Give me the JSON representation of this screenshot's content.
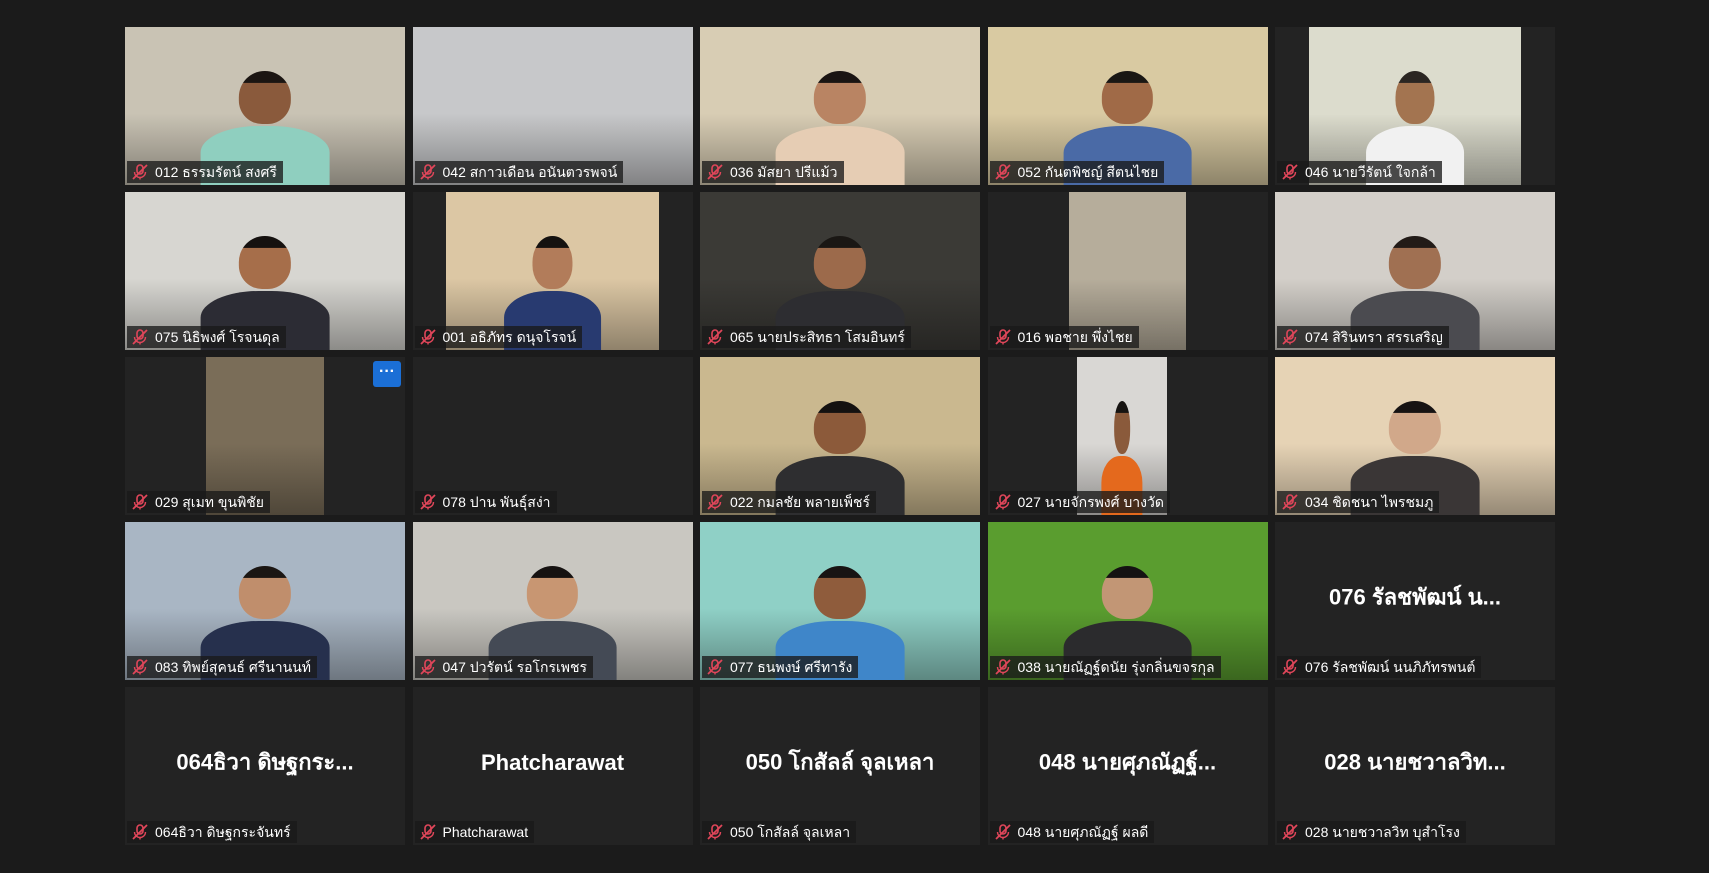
{
  "meeting": {
    "more_options_symbol": "···",
    "participants": [
      {
        "label": "012 ธรรมรัตน์ สงศรี",
        "video": true,
        "bg": "#c9c3b4",
        "skin": "#8a5a3c",
        "hair": "#1b1512",
        "shirt": "#8fcfbf"
      },
      {
        "label": "042 สกาวเดือน อนันตวรพจน์",
        "video": true,
        "bg": "#c7c8ca",
        "skin": null,
        "hair": null,
        "shirt": null
      },
      {
        "label": "036 มัสยา ปรีแม้ว",
        "video": true,
        "bg": "#d8cdb4",
        "skin": "#b98463",
        "hair": "#1a1412",
        "shirt": "#e6cdb4"
      },
      {
        "label": "052 กันตพิชญ์ สีตนไชย",
        "video": true,
        "bg": "#d9caa2",
        "skin": "#a06a47",
        "hair": "#1a1714",
        "shirt": "#4a6aa6"
      },
      {
        "label": "046 นายวีรัตน์ ใจกล้า",
        "video": true,
        "bg": "#dcdccd",
        "skin": "#a37450",
        "hair": "#2b2622",
        "shirt": "#f1f1f1"
      },
      {
        "label": "075 นิธิพงศ์ โรจนดุล",
        "video": true,
        "bg": "#d7d6d1",
        "skin": "#a66e4a",
        "hair": "#15110f",
        "shirt": "#2c2c34"
      },
      {
        "label": "001 อธิภัทร ดนุจโรจน์",
        "video": true,
        "bg": "#dcc7a4",
        "skin": "#b27c5a",
        "hair": "#151210",
        "shirt": "#283a70"
      },
      {
        "label": "065 นายประสิทธา โสมอินทร์",
        "video": true,
        "bg": "#3b3a36",
        "skin": "#9c6a4b",
        "hair": "#1a1714",
        "shirt": "#2d2d31"
      },
      {
        "label": "016 พอชาย พึ่งไชย",
        "video": true,
        "bg": "#b6ad9b",
        "skin": null,
        "hair": null,
        "shirt": null
      },
      {
        "label": "074 สิรินทรา สรรเสริญ",
        "video": true,
        "bg": "#d3cfc9",
        "skin": "#a07052",
        "hair": "#221b17",
        "shirt": "#4b4b50"
      },
      {
        "label": "029 สุเมท ขุนพิชัย",
        "video": true,
        "bg": "#7a6d58",
        "skin": null,
        "hair": null,
        "shirt": null,
        "more": true
      },
      {
        "label": "078 ปาน พันธุ์สง่า",
        "video": false,
        "bg": null,
        "skin": null,
        "hair": null,
        "shirt": null
      },
      {
        "label": "022 กมลชัย พลายเพ็ชร์",
        "video": true,
        "bg": "#cab88f",
        "skin": "#8c5a3a",
        "hair": "#141110",
        "shirt": "#2e2e30"
      },
      {
        "label": "027 นายจักรพงศ์ บางวัด",
        "video": true,
        "bg": "#d9d7d4",
        "skin": "#8a5a3b",
        "hair": "#161311",
        "shirt": "#e4691d"
      },
      {
        "label": "034 ชิดชนา ไพรชมภู",
        "video": true,
        "bg": "#e6d3b5",
        "skin": "#d1a88a",
        "hair": "#171313",
        "shirt": "#3a3636"
      },
      {
        "label": "083 ทิพย์สุคนธ์ ศรีนานนท์",
        "video": true,
        "bg": "#a9b6c4",
        "skin": "#c08e6c",
        "hair": "#1b1613",
        "shirt": "#26304d"
      },
      {
        "label": "047 ปวรัตน์ รอโกรเพชร",
        "video": true,
        "bg": "#c9c7c1",
        "skin": "#c89672",
        "hair": "#161211",
        "shirt": "#444a55"
      },
      {
        "label": "077 ธนพงษ์ ศรีทารัง",
        "video": true,
        "bg": "#8fd0c6",
        "skin": "#8f5c3c",
        "hair": "#181413",
        "shirt": "#3f86c9"
      },
      {
        "label": "038 นายณัฏฐ์ดนัย รุ่งกลิ่นขจรกุล",
        "video": true,
        "bg": "#5a9d2f",
        "skin": "#c29675",
        "hair": "#151212",
        "shirt": "#2b2b2d"
      },
      {
        "label": "076 รัลชพัฒน์ นนภิภัทรพนต์",
        "video": false,
        "display_name": "076 รัลชพัฒน์ น...",
        "bg": null,
        "skin": null,
        "hair": null,
        "shirt": null
      },
      {
        "label": "064ธิวา ดิษฐกระจันทร์",
        "video": false,
        "display_name": "064ธิวา ดิษฐกระ...",
        "bg": null,
        "skin": null,
        "hair": null,
        "shirt": null
      },
      {
        "label": "Phatcharawat",
        "video": false,
        "display_name": "Phatcharawat",
        "bg": null,
        "skin": null,
        "hair": null,
        "shirt": null
      },
      {
        "label": "050 โกสัลล์ จุลเหลา",
        "video": false,
        "display_name": "050 โกสัลล์ จุลเหลา",
        "bg": null,
        "skin": null,
        "hair": null,
        "shirt": null
      },
      {
        "label": "048 นายศุภณัฏฐ์ ผลดี",
        "video": false,
        "display_name": "048 นายศุภณัฏฐ์...",
        "bg": null,
        "skin": null,
        "hair": null,
        "shirt": null
      },
      {
        "label": "028 นายชวาลวิท บุสำโรง",
        "video": false,
        "display_name": "028 นายชวาลวิท...",
        "bg": null,
        "skin": null,
        "hair": null,
        "shirt": null
      }
    ]
  },
  "colors": {
    "background": "#1b1b1b",
    "tile": "#232323",
    "mic_muted": "#e0465a",
    "more_button": "#1b6fd6"
  },
  "icons": {
    "mic_muted": "mic-off-icon",
    "more": "more-options-icon"
  }
}
